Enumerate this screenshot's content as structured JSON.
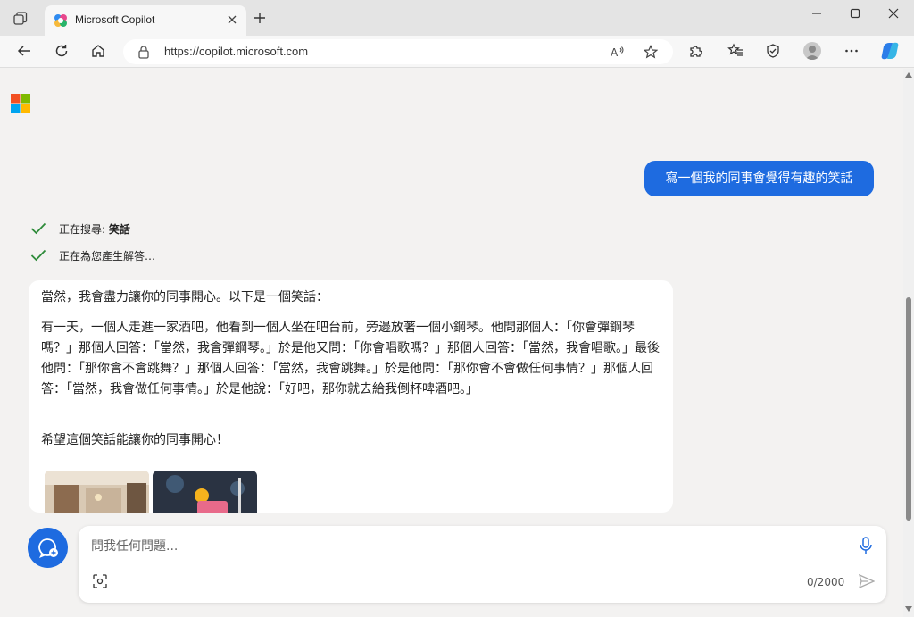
{
  "browser": {
    "tab_title": "Microsoft Copilot",
    "url": "https://copilot.microsoft.com"
  },
  "chat": {
    "user_message": "寫一個我的同事會覺得有趣的笑話",
    "status_items": [
      {
        "prefix": "正在搜尋: ",
        "term": "笑話"
      },
      {
        "prefix": "正在為您產生解答…",
        "term": ""
      }
    ],
    "answer": {
      "intro": "當然，我會盡力讓你的同事開心。以下是一個笑話：",
      "joke": "有一天，一個人走進一家酒吧，他看到一個人坐在吧台前，旁邊放著一個小鋼琴。他問那個人：「你會彈鋼琴嗎？」那個人回答：「當然，我會彈鋼琴。」於是他又問：「你會唱歌嗎？」那個人回答：「當然，我會唱歌。」最後他問：「那你會不會跳舞？」那個人回答：「當然，我會跳舞。」於是他問：「那你會不會做任何事情？」那個人回答：「當然，我會做任何事情。」於是他說：「好吧，那你就去給我倒杯啤酒吧。」",
      "closing": "希望這個笑話能讓你的同事開心！"
    }
  },
  "composer": {
    "placeholder": "問我任何問題...",
    "char_count": "0/2000"
  },
  "icons": {
    "tab_actions": "tab-actions-icon",
    "favicon": "copilot-favicon-icon",
    "mic": "microphone-icon",
    "send": "send-icon",
    "visual_search": "visual-search-icon",
    "new_topic": "new-topic-icon"
  },
  "colors": {
    "accent": "#1e6be0",
    "check_green": "#2e8b3a",
    "page_bg": "#f3f2f1"
  }
}
